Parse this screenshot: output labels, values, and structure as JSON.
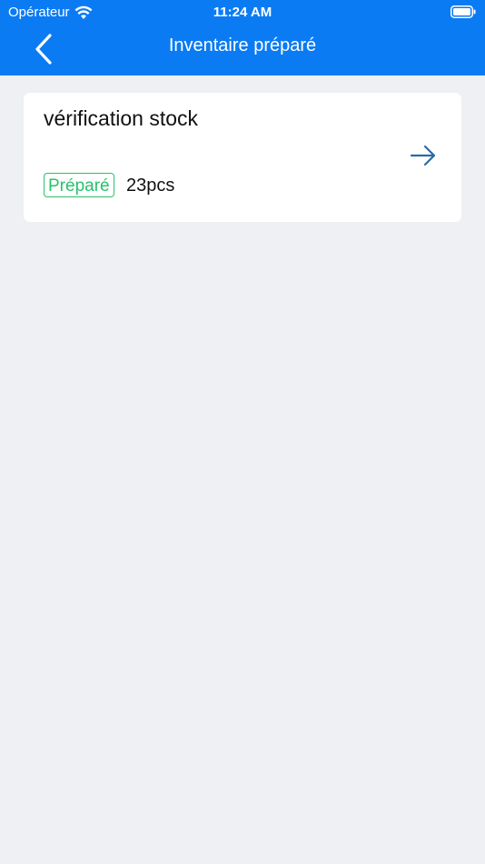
{
  "status_bar": {
    "carrier": "Opérateur",
    "time": "11:24 AM",
    "wifi_icon": "wifi-icon",
    "battery_icon": "battery-icon"
  },
  "nav": {
    "title": "Inventaire préparé",
    "back_icon": "chevron-left-icon"
  },
  "inventory_list": [
    {
      "name": "vérification stock",
      "status": "Préparé",
      "quantity": "23pcs",
      "arrow_icon": "arrow-right-icon"
    }
  ],
  "colors": {
    "header": "#0b7bf4",
    "background": "#eef0f4",
    "status_green": "#26c36b",
    "arrow_blue": "#2a6aa8"
  }
}
